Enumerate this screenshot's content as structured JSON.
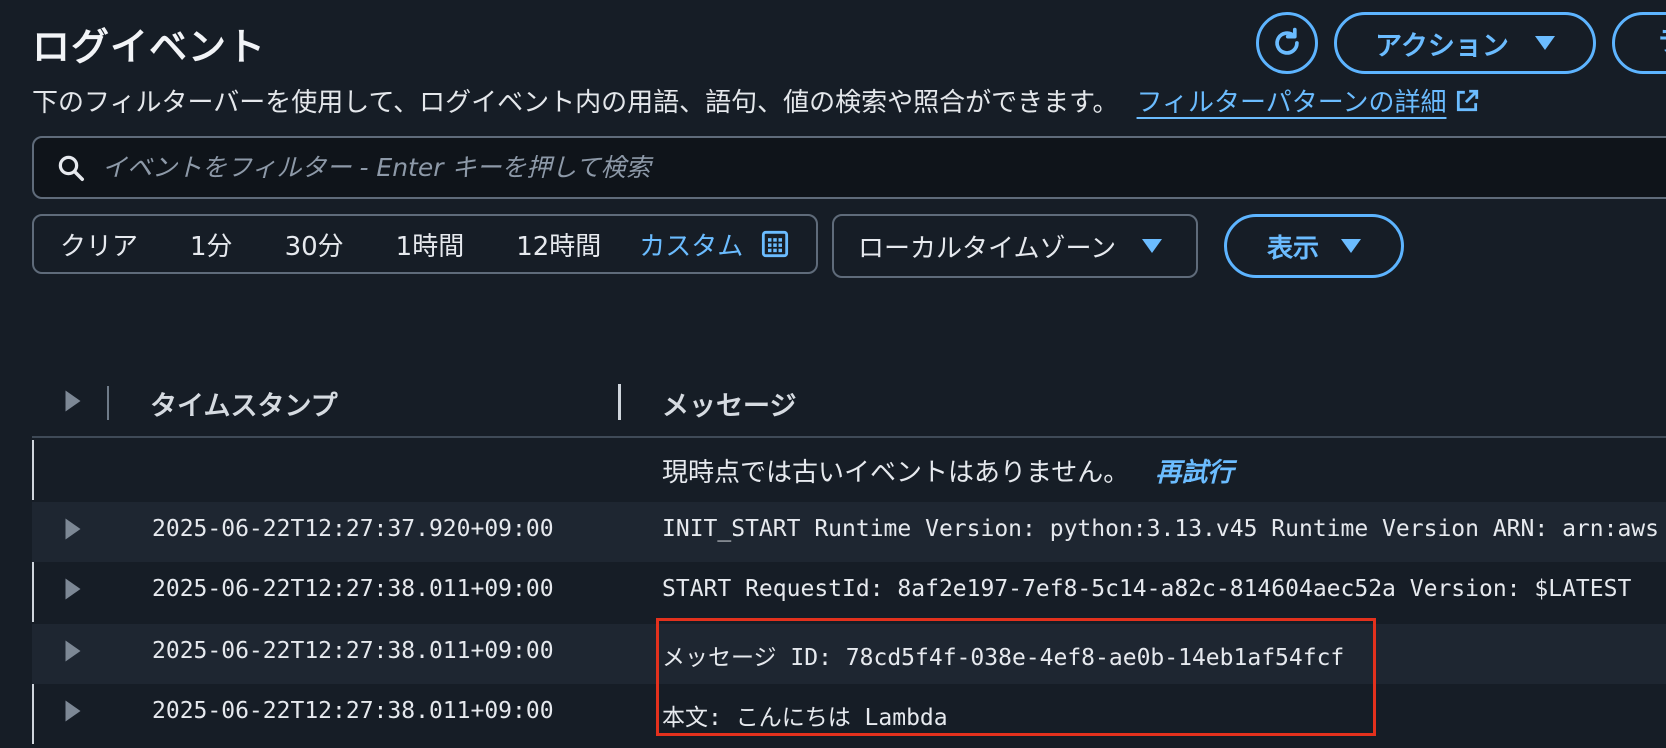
{
  "header": {
    "title": "ログイベント",
    "action_label": "アクション",
    "cut_button_label": "ラ"
  },
  "description": {
    "text": "下のフィルターバーを使用して、ログイベント内の用語、語句、値の検索や照合ができます。",
    "link_label": "フィルターパターンの詳細"
  },
  "search": {
    "placeholder": "イベントをフィルター - Enter キーを押して検索"
  },
  "time_range": {
    "options": [
      "クリア",
      "1分",
      "30分",
      "1時間",
      "12時間"
    ],
    "custom_label": "カスタム"
  },
  "timezone": {
    "selected": "ローカルタイムゾーン"
  },
  "display": {
    "label": "表示"
  },
  "table": {
    "columns": {
      "timestamp": "タイムスタンプ",
      "message": "メッセージ"
    },
    "no_older_events": "現時点では古いイベントはありません。",
    "retry_label": "再試行",
    "rows": [
      {
        "timestamp": "2025-06-22T12:27:37.920+09:00",
        "message": "INIT_START Runtime Version: python:3.13.v45 Runtime Version ARN: arn:aws"
      },
      {
        "timestamp": "2025-06-22T12:27:38.011+09:00",
        "message": "START RequestId: 8af2e197-7ef8-5c14-a82c-814604aec52a Version: $LATEST"
      },
      {
        "timestamp": "2025-06-22T12:27:38.011+09:00",
        "message": "メッセージ ID: 78cd5f4f-038e-4ef8-ae0b-14eb1af54fcf"
      },
      {
        "timestamp": "2025-06-22T12:27:38.011+09:00",
        "message": "本文: こんにちは Lambda"
      }
    ]
  },
  "colors": {
    "background": "#161d26",
    "accent": "#6bbcff",
    "highlight": "#e3311d"
  },
  "icons": [
    "refresh-icon",
    "caret-down-icon",
    "external-link-icon",
    "search-icon",
    "calendar-icon",
    "expand-icon"
  ]
}
